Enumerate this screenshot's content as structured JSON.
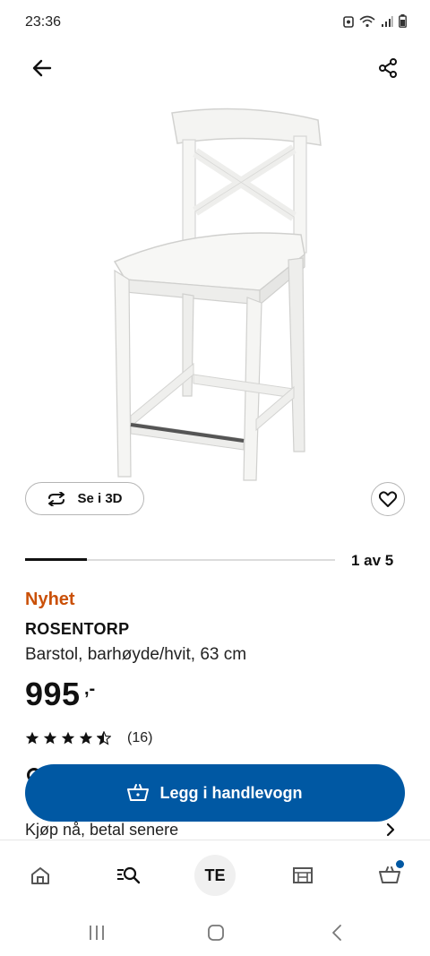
{
  "status": {
    "time": "23:36"
  },
  "product": {
    "badge": "Nyhet",
    "name": "ROSENTORP",
    "description": "Barstol, barhøyde/hvit, 63 cm",
    "price": "995",
    "price_suffix": ",-",
    "rating_value": 4.5,
    "rating_max": 5,
    "rating_count": "(16)"
  },
  "gallery": {
    "see_3d_label": "Se i 3D",
    "position_text": "1 av 5",
    "current": 1,
    "total": 5
  },
  "actions": {
    "add_to_cart_label": "Legg i handlevogn",
    "pay_later_label": "Kjøp nå, betal senere"
  },
  "bottom_nav": {
    "items": [
      {
        "icon": "home-icon"
      },
      {
        "icon": "search-icon"
      },
      {
        "label": "TE"
      },
      {
        "icon": "store-icon"
      },
      {
        "icon": "cart-icon",
        "has_badge": true
      }
    ]
  },
  "colors": {
    "accent": "#0058a3",
    "badge_new": "#ca5008"
  }
}
